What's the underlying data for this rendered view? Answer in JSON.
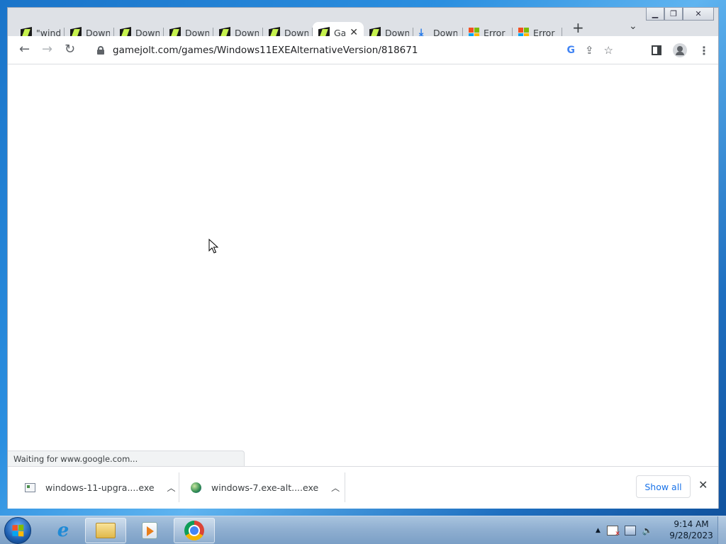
{
  "browser": {
    "tabs": [
      {
        "label": "\"wind",
        "favicon": "gamejolt-icon"
      },
      {
        "label": "Down",
        "favicon": "gamejolt-icon"
      },
      {
        "label": "Down",
        "favicon": "gamejolt-icon"
      },
      {
        "label": "Down",
        "favicon": "gamejolt-icon"
      },
      {
        "label": "Down",
        "favicon": "gamejolt-icon"
      },
      {
        "label": "Down",
        "favicon": "gamejolt-icon"
      },
      {
        "label": "Ga",
        "favicon": "gamejolt-icon",
        "active": true
      },
      {
        "label": "Down",
        "favicon": "gamejolt-icon"
      },
      {
        "label": "Down",
        "favicon": "download-icon"
      },
      {
        "label": "Error",
        "favicon": "microsoft-icon"
      },
      {
        "label": "Error",
        "favicon": "microsoft-icon"
      }
    ],
    "new_tab_glyph": "+",
    "tab_search_glyph": "⌄",
    "url": "gamejolt.com/games/Windows11EXEAlternativeVersion/818671",
    "status_text": "Waiting for www.google.com...",
    "accent_color": "#1a73e8"
  },
  "downloads": {
    "items": [
      {
        "filename": "windows-11-upgra....exe"
      },
      {
        "filename": "windows-7.exe-alt....exe"
      }
    ],
    "show_all_label": "Show all"
  },
  "taskbar": {
    "clock_time": "9:14 AM",
    "clock_date": "9/28/2023",
    "tray_expand_glyph": "▲"
  }
}
